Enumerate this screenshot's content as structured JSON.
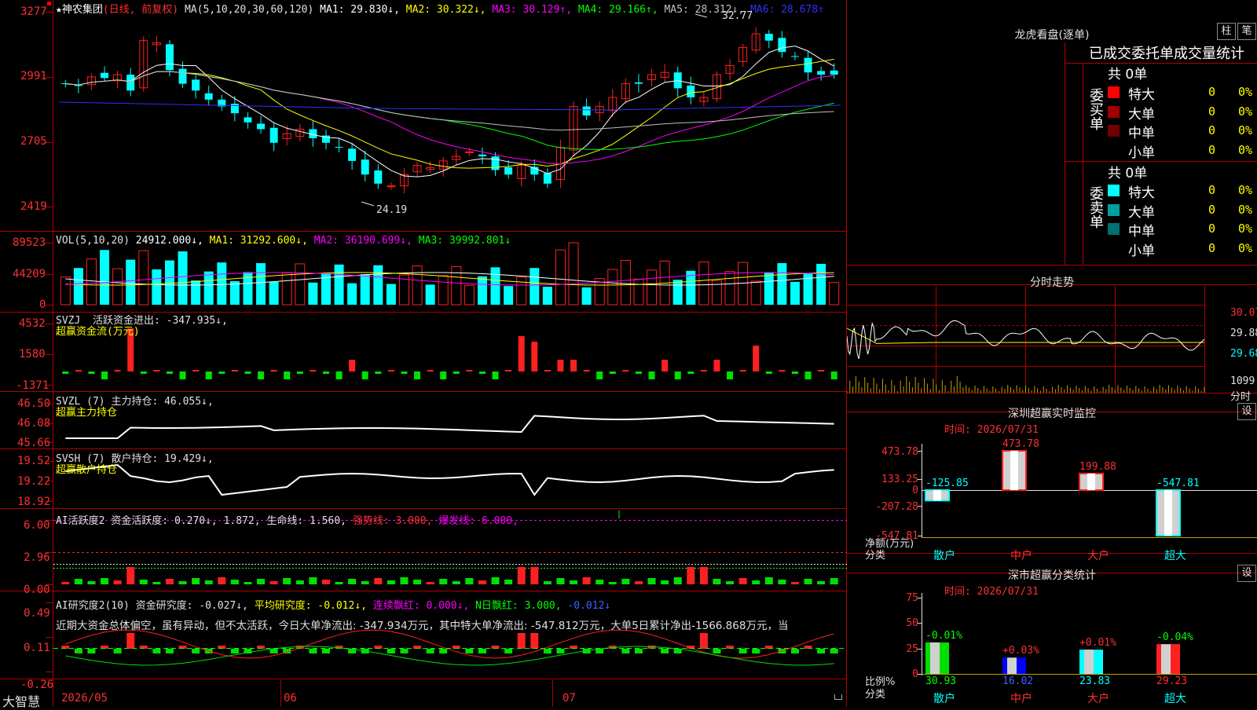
{
  "app": {
    "logo": "大智慧"
  },
  "main": {
    "header": {
      "stock_name": "★神农集团",
      "period": "(日线, 前复权)",
      "ma_def": "MA(5,10,20,30,60,120)",
      "ma1": "MA1: 29.830↓,",
      "ma2": "MA2: 30.322↓,",
      "ma3": "MA3: 30.129↑,",
      "ma4": "MA4: 29.166↑,",
      "ma5": "MA5: 28.312↓,",
      "ma6": "MA6: 28.678↑"
    },
    "yticks": [
      "3277",
      "2991",
      "2705",
      "2419"
    ],
    "high_label": "32.77",
    "low_label": "24.19"
  },
  "vol": {
    "header": {
      "name": "VOL(5,10,20)",
      "v": "24912.000↓,",
      "ma1": "MA1: 31292.600↓,",
      "ma2": "MA2: 36190.699↓,",
      "ma3": "MA3: 39992.801↓"
    },
    "yticks": [
      "89523",
      "44209",
      "0"
    ]
  },
  "svzj": {
    "header": {
      "name": "SVZJ  活跃资金进出: -347.935↓,",
      "sub": "超赢资金流(万元)"
    },
    "yticks": [
      "4532",
      "1580",
      "-1371"
    ]
  },
  "svzl": {
    "header": {
      "name": "SVZL (7) 主力持仓: 46.055↓,",
      "sub": "超赢主力持仓"
    },
    "yticks": [
      "46.50",
      "46.08",
      "45.66"
    ]
  },
  "svsh": {
    "header": {
      "name": "SVSH (7) 散户持仓: 19.429↓,",
      "sub": "超赢散户持仓"
    },
    "yticks": [
      "19.52",
      "19.22",
      "18.92"
    ]
  },
  "ai1": {
    "header": {
      "a": "AI活跃度2 资金活跃度: 0.270↓, 1.872,",
      "b": "生命线: 1.560,",
      "c": "强势线: 3.000,",
      "d": "爆发线: 6.000,"
    },
    "yticks": [
      "6.00",
      "2.96",
      "0.00"
    ]
  },
  "ai2": {
    "header": {
      "a": "AI研究度2(10) 资金研究度: -0.027↓,",
      "b": "平均研究度: -0.012↓,",
      "c": "连续飘红: 0.000↓,",
      "d": "N日飘红: 3.000,",
      "e": "-0.012↓"
    },
    "comment": "近期大资金总体偏空，虽有异动，但不太活跃，今日大单净流出: -347.934万元，其中特大单净流出: -547.812万元，大单5日累计净出-1566.868万元，当",
    "yticks": [
      "0.49",
      "0.11",
      "-0.26"
    ]
  },
  "xaxis": {
    "labels": [
      "2026/05",
      "06",
      "07"
    ]
  },
  "right": {
    "dragon": {
      "title": "龙虎看盘(逐单)",
      "btn1": "柱",
      "btn2": "笔",
      "subtitle": "已成交委托单成交量统计"
    },
    "buy": {
      "side": "委买单",
      "count": "共 0单",
      "rows": [
        {
          "name": "特大",
          "count": "0",
          "pct": "0%",
          "color": "#ff0000"
        },
        {
          "name": "大单",
          "count": "0",
          "pct": "0%",
          "color": "#a00000"
        },
        {
          "name": "中单",
          "count": "0",
          "pct": "0%",
          "color": "#700000"
        },
        {
          "name": "小单",
          "count": "0",
          "pct": "0%",
          "color": ""
        }
      ]
    },
    "sell": {
      "side": "委卖单",
      "count": "共 0单",
      "rows": [
        {
          "name": "特大",
          "count": "0",
          "pct": "0%",
          "color": "#00ffff"
        },
        {
          "name": "大单",
          "count": "0",
          "pct": "0%",
          "color": "#00a0a0"
        },
        {
          "name": "中单",
          "count": "0",
          "pct": "0%",
          "color": "#007070"
        },
        {
          "name": "小单",
          "count": "0",
          "pct": "0%",
          "color": ""
        }
      ]
    },
    "intraday": {
      "title": "分时走势",
      "y1": "30.07",
      "y2": "29.88",
      "y3": "29.68",
      "vol": "1099",
      "vol_unit": "分时"
    },
    "monitor": {
      "title": "深圳超赢实时监控",
      "btn": "设",
      "time": "时间: 2026/07/31",
      "yticks": [
        "473.78",
        "133.25",
        "0",
        "-207.28",
        "-547.81"
      ],
      "axis_label1": "净额(万元)",
      "axis_label2": "分类",
      "categories": [
        "散户",
        "中户",
        "大户",
        "超大"
      ],
      "values": [
        -125.85,
        473.78,
        199.88,
        -547.81
      ],
      "value_labels": [
        "-125.85",
        "473.78",
        "199.88",
        "-547.81"
      ]
    },
    "classify": {
      "title": "深市超赢分类统计",
      "btn": "设",
      "time": "时间: 2026/07/31",
      "yticks": [
        "75",
        "50",
        "25",
        "0"
      ],
      "axis_label1": "比例%",
      "axis_label2": "分类",
      "categories": [
        "散户",
        "中户",
        "大户",
        "超大"
      ],
      "values": [
        30.93,
        16.02,
        23.83,
        29.23
      ],
      "changes": [
        "-0.01%",
        "+0.03%",
        "+0.01%",
        "-0.04%"
      ]
    }
  }
}
